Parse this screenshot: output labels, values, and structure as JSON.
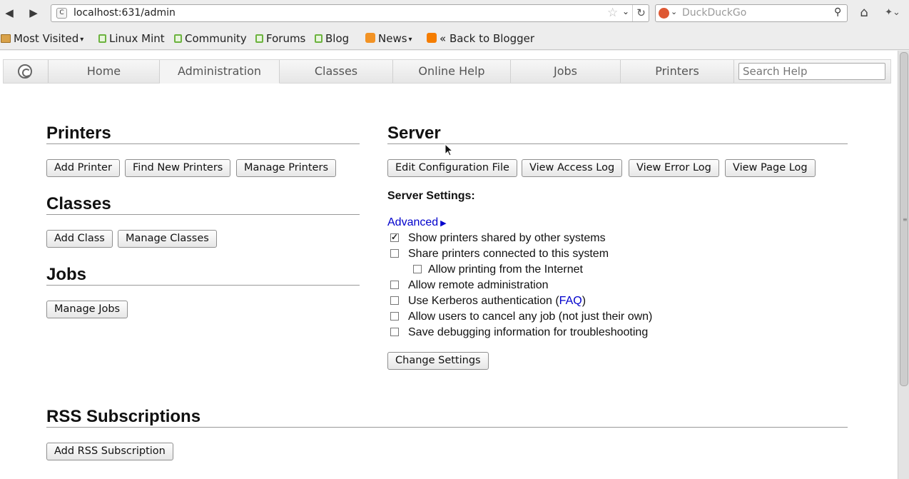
{
  "browser": {
    "url": "localhost:631/admin",
    "search_placeholder": "DuckDuckGo",
    "bookmarks": [
      {
        "label": "Most Visited",
        "icon": "folder-icon",
        "dropdown": true
      },
      {
        "label": "Linux Mint",
        "icon": "mint-icon"
      },
      {
        "label": "Community",
        "icon": "mint-icon"
      },
      {
        "label": "Forums",
        "icon": "mint-icon"
      },
      {
        "label": "Blog",
        "icon": "mint-icon"
      },
      {
        "label": "News",
        "icon": "rss-icon",
        "dropdown": true
      },
      {
        "label": "« Back to Blogger",
        "icon": "blogger-icon"
      }
    ]
  },
  "cups": {
    "tabs": [
      "Home",
      "Administration",
      "Classes",
      "Online Help",
      "Jobs",
      "Printers"
    ],
    "active_tab": "Administration",
    "search_placeholder": "Search Help"
  },
  "printers": {
    "heading": "Printers",
    "buttons": [
      "Add Printer",
      "Find New Printers",
      "Manage Printers"
    ]
  },
  "classes": {
    "heading": "Classes",
    "buttons": [
      "Add Class",
      "Manage Classes"
    ]
  },
  "jobs": {
    "heading": "Jobs",
    "buttons": [
      "Manage Jobs"
    ]
  },
  "server": {
    "heading": "Server",
    "buttons": [
      "Edit Configuration File",
      "View Access Log",
      "View Error Log",
      "View Page Log"
    ],
    "settings_label": "Server Settings:",
    "advanced_link": "Advanced",
    "options": [
      {
        "label": "Show printers shared by other systems",
        "checked": true
      },
      {
        "label": "Share printers connected to this system",
        "checked": false
      },
      {
        "label": "Allow printing from the Internet",
        "checked": false
      },
      {
        "label": "Allow remote administration",
        "checked": false
      },
      {
        "label_before": "Use Kerberos authentication (",
        "link": "FAQ",
        "label_after": ")",
        "checked": false
      },
      {
        "label": "Allow users to cancel any job (not just their own)",
        "checked": false
      },
      {
        "label": "Save debugging information for troubleshooting",
        "checked": false
      }
    ],
    "change_button": "Change Settings"
  },
  "rss": {
    "heading": "RSS Subscriptions",
    "button": "Add RSS Subscription"
  }
}
